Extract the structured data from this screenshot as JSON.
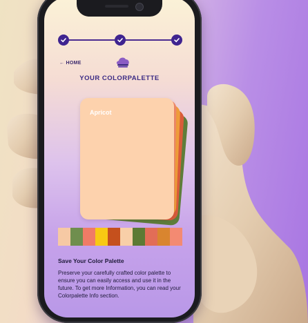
{
  "progress": {
    "steps": [
      {
        "status": "complete"
      },
      {
        "status": "complete"
      },
      {
        "status": "complete"
      }
    ]
  },
  "nav": {
    "home_label": "← HOME"
  },
  "header": {
    "logo_icon": "palette-logo-icon",
    "title": "YOUR COLORPALETTE"
  },
  "palette": {
    "primary_card": {
      "name": "Apricot",
      "color": "#fdd2ad"
    },
    "stacked_card_colors": [
      "#5e7d3a",
      "#d95b3a",
      "#ef9d3a",
      "#f28b6a"
    ],
    "swatches": [
      "#f6c9a4",
      "#6f8e4e",
      "#f07b66",
      "#f8c913",
      "#c5501d",
      "#f8cfa8",
      "#5c7a34",
      "#e26d57",
      "#d9852f",
      "#f38a72"
    ]
  },
  "info": {
    "title": "Save Your Color Palette",
    "description": "Preserve your carefully crafted color palette to ensure you can easily access and use it in the future. To get more Information, you can read your Colorpalette Info section."
  }
}
